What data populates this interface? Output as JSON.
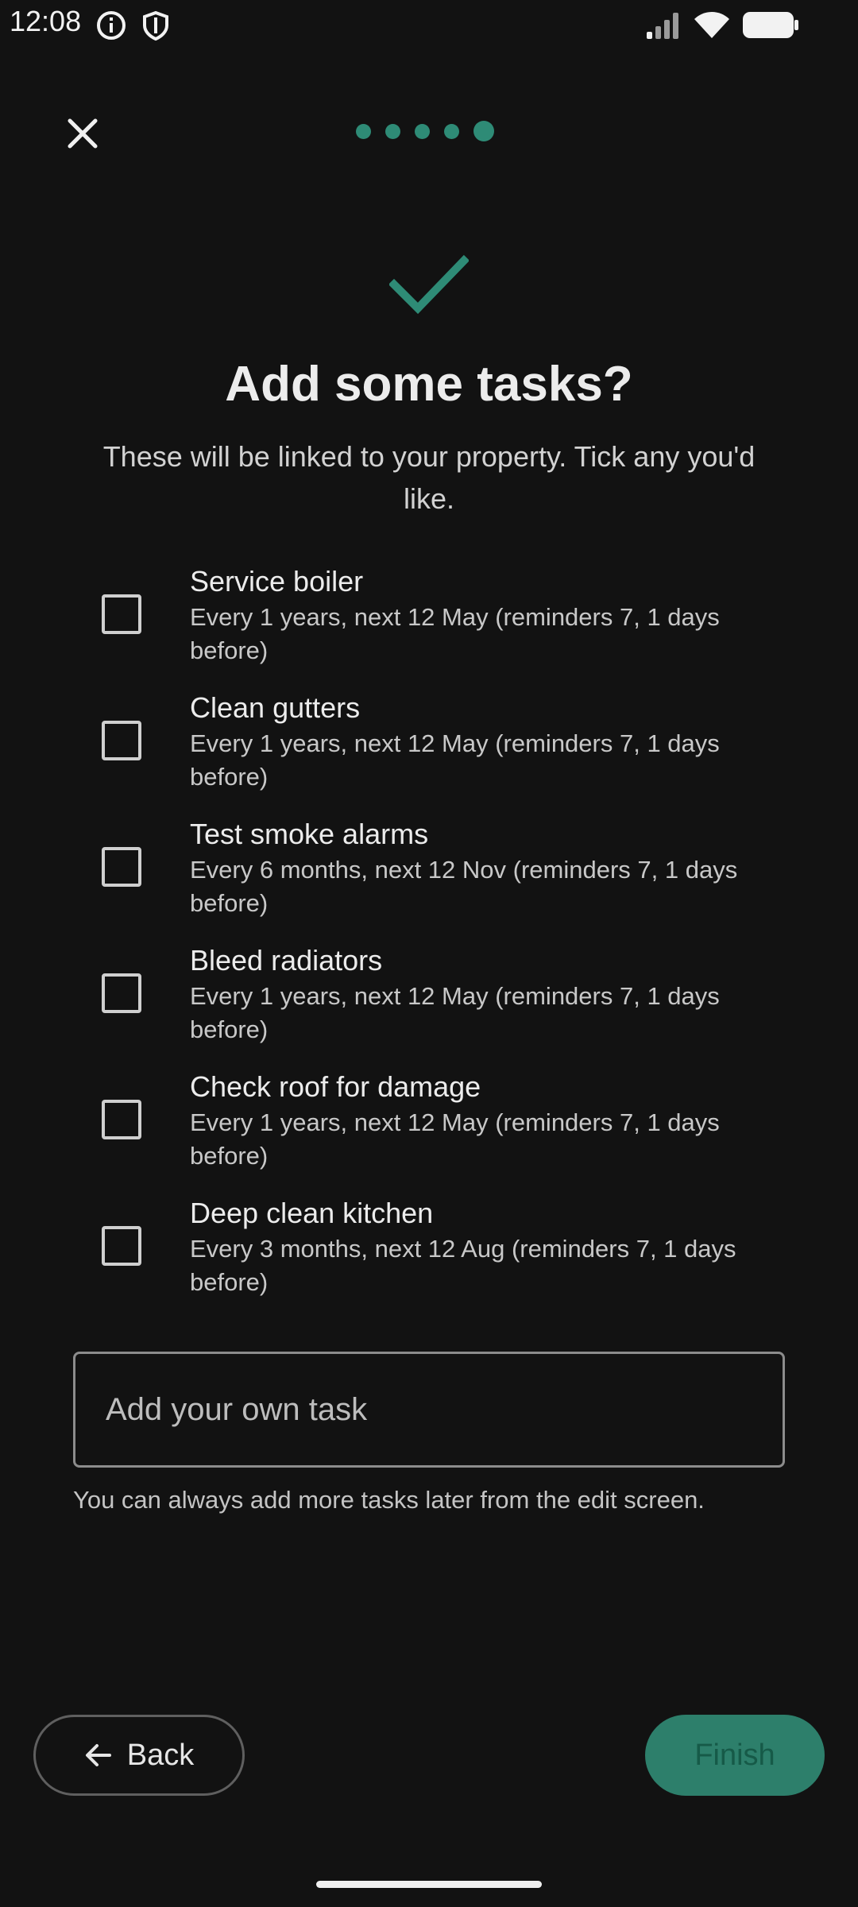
{
  "status_bar": {
    "time": "12:08",
    "left_icons": [
      "info-icon",
      "shield-icon"
    ],
    "right_icons": [
      "signal-icon",
      "wifi-icon",
      "battery-icon"
    ]
  },
  "header": {
    "close_icon": "close-icon",
    "progress": {
      "total_steps": 5,
      "current_step": 5
    }
  },
  "hero": {
    "icon": "checkmark-icon",
    "accent_color": "#2e8b76"
  },
  "title": "Add some tasks?",
  "subtitle": "These will be linked to your property. Tick any you'd like.",
  "tasks": [
    {
      "name": "Service boiler",
      "detail": "Every 1 years, next 12 May (reminders 7, 1 days before)",
      "checked": false
    },
    {
      "name": "Clean gutters",
      "detail": "Every 1 years, next 12 May (reminders 7, 1 days before)",
      "checked": false
    },
    {
      "name": "Test smoke alarms",
      "detail": "Every 6 months, next 12 Nov (reminders 7, 1 days before)",
      "checked": false
    },
    {
      "name": "Bleed radiators",
      "detail": "Every 1 years, next 12 May (reminders 7, 1 days before)",
      "checked": false
    },
    {
      "name": "Check roof for damage",
      "detail": "Every 1 years, next 12 May (reminders 7, 1 days before)",
      "checked": false
    },
    {
      "name": "Deep clean kitchen",
      "detail": "Every 3 months, next 12 Aug (reminders 7, 1 days before)",
      "checked": false
    }
  ],
  "own_task": {
    "placeholder": "Add your own task",
    "value": ""
  },
  "hint": "You can always add more tasks later from the edit screen.",
  "footer": {
    "back_label": "Back",
    "back_icon": "arrow-left-icon",
    "finish_label": "Finish",
    "finish_color": "#2d7f6b"
  }
}
